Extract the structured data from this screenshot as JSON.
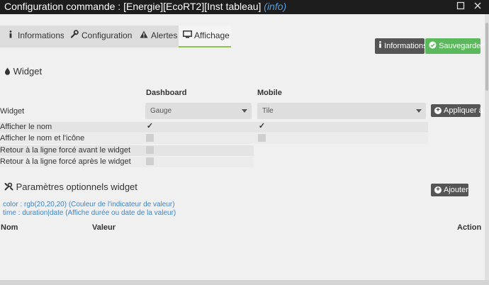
{
  "titlebar": {
    "title": "Configuration commande : [Energie][EcoRT2][Inst tableau]",
    "info": "(info)",
    "minimize_icon": "square-icon",
    "close_icon": "close-icon"
  },
  "tabs": [
    {
      "label": "Informations",
      "icon": "info-icon"
    },
    {
      "label": "Configuration",
      "icon": "wrench-icon"
    },
    {
      "label": "Alertes",
      "icon": "warning-icon"
    },
    {
      "label": "Affichage",
      "icon": "monitor-icon",
      "active": true
    }
  ],
  "toolbar": {
    "informations_label": "Informations",
    "sauvegarder_label": "Sauvegarder"
  },
  "widget_section": {
    "title": "Widget",
    "col_dashboard": "Dashboard",
    "col_mobile": "Mobile",
    "widget_label": "Widget",
    "dashboard_value": "Gauge",
    "mobile_value": "Tile",
    "apply_label": "Appliquer à",
    "rows": [
      {
        "label": "Afficher le nom",
        "dashboard": true,
        "mobile": true
      },
      {
        "label": "Afficher le nom et l'icône",
        "dashboard": false,
        "mobile": false
      },
      {
        "label": "Retour à la ligne forcé avant le widget",
        "dashboard": false
      },
      {
        "label": "Retour à la ligne forcé après le widget",
        "dashboard": false
      }
    ]
  },
  "params_section": {
    "title": "Paramètres optionnels widget",
    "add_label": "Ajouter",
    "hints": [
      "color : rgb(20,20,20) (Couleur de l'indicateur de valeur)",
      "time : duration|date (Affiche durée ou date de la valeur)"
    ],
    "table_headers": {
      "nom": "Nom",
      "valeur": "Valeur",
      "action": "Action"
    }
  },
  "colors": {
    "accent_green": "#5cb85c",
    "link_blue": "#3f85c8",
    "title_bg": "#1d1d1d"
  }
}
